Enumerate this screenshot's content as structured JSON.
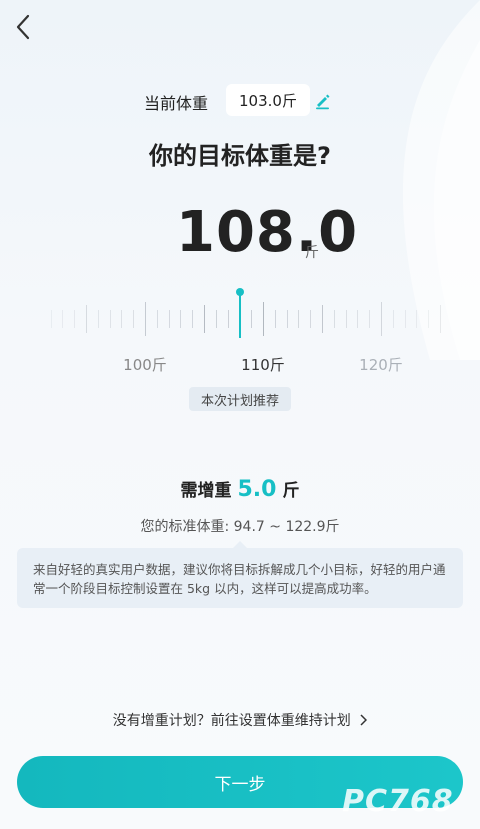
{
  "current": {
    "label": "当前体重",
    "value": "103.0斤"
  },
  "question": "你的目标体重是?",
  "target": {
    "value": "108.0",
    "unit": "斤"
  },
  "ruler": {
    "labels": [
      "100斤",
      "110斤",
      "120斤"
    ],
    "selected_value": 108.0
  },
  "recommend_label": "本次计划推荐",
  "need": {
    "label": "需增重",
    "value": "5.0",
    "unit": "斤"
  },
  "standard_text": "您的标准体重: 94.7 ~ 122.9斤",
  "tip_text": "来自好轻的真实用户数据，建议你将目标拆解成几个小目标，好轻的用户通常一个阶段目标控制设置在 5kg 以内，这样可以提高成功率。",
  "link_text": "没有增重计划？前往设置体重维持计划",
  "next_label": "下一步",
  "watermark": "PC768",
  "colors": {
    "accent": "#17bfc5"
  }
}
